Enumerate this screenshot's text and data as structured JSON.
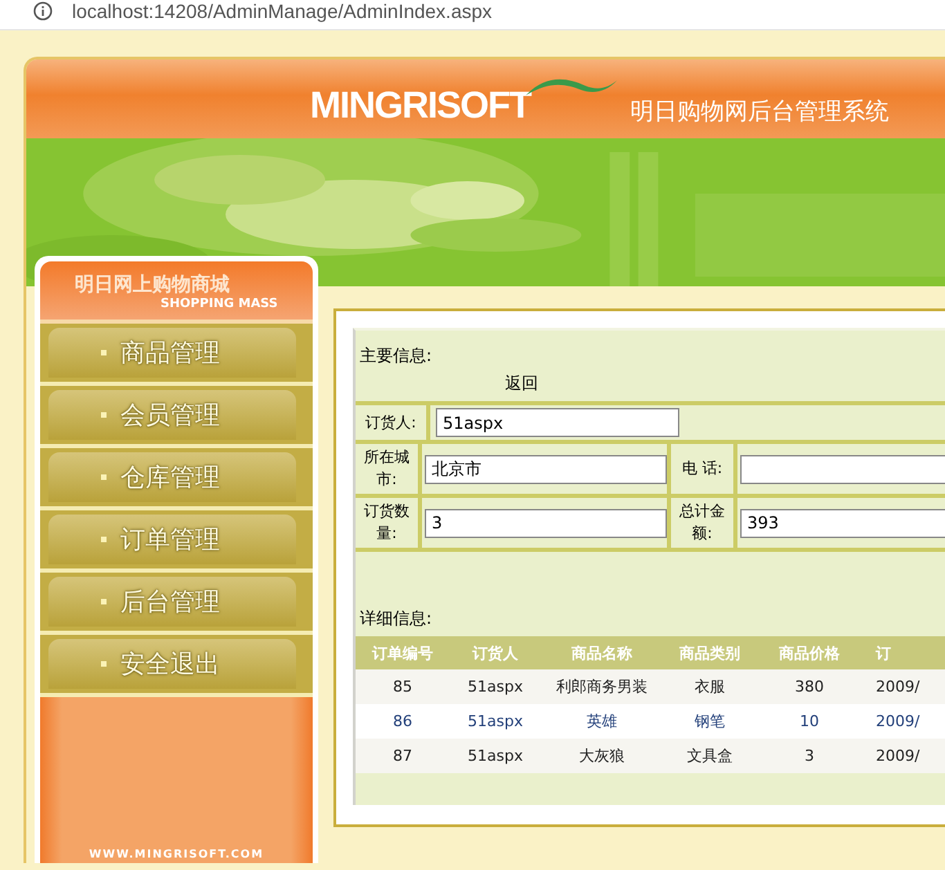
{
  "address_bar": {
    "url": "localhost:14208/AdminManage/AdminIndex.aspx"
  },
  "header": {
    "logo": "MINGRISOFT",
    "title": "明日购物网后台管理系统"
  },
  "sidebar": {
    "title": "明日网上购物商城",
    "subtitle": "SHOPPING MASS",
    "items": [
      {
        "label": "商品管理"
      },
      {
        "label": "会员管理"
      },
      {
        "label": "仓库管理"
      },
      {
        "label": "订单管理"
      },
      {
        "label": "后台管理"
      },
      {
        "label": "安全退出"
      }
    ],
    "footer": "WWW.MINGRISOFT.COM"
  },
  "main_info": {
    "heading": "主要信息:",
    "back_link": "返回",
    "rows": [
      [
        {
          "label": "订货人:",
          "value": "51aspx"
        }
      ],
      [
        {
          "label": "所在城市:",
          "value": "北京市"
        },
        {
          "label": "电 话:"
        }
      ],
      [
        {
          "label": "订货数量:",
          "value": "3"
        },
        {
          "label": "总计金额:",
          "value": "393"
        }
      ]
    ]
  },
  "detail": {
    "heading": "详细信息:",
    "columns": [
      "订单编号",
      "订货人",
      "商品名称",
      "商品类别",
      "商品价格",
      "订"
    ],
    "rows": [
      {
        "selected": false,
        "cells": [
          "85",
          "51aspx",
          "利郎商务男装",
          "衣服",
          "380",
          "2009/"
        ]
      },
      {
        "selected": true,
        "cells": [
          "86",
          "51aspx",
          "英雄",
          "钢笔",
          "10",
          "2009/"
        ]
      },
      {
        "selected": false,
        "cells": [
          "87",
          "51aspx",
          "大灰狼",
          "文具盒",
          "3",
          "2009/"
        ]
      }
    ]
  }
}
